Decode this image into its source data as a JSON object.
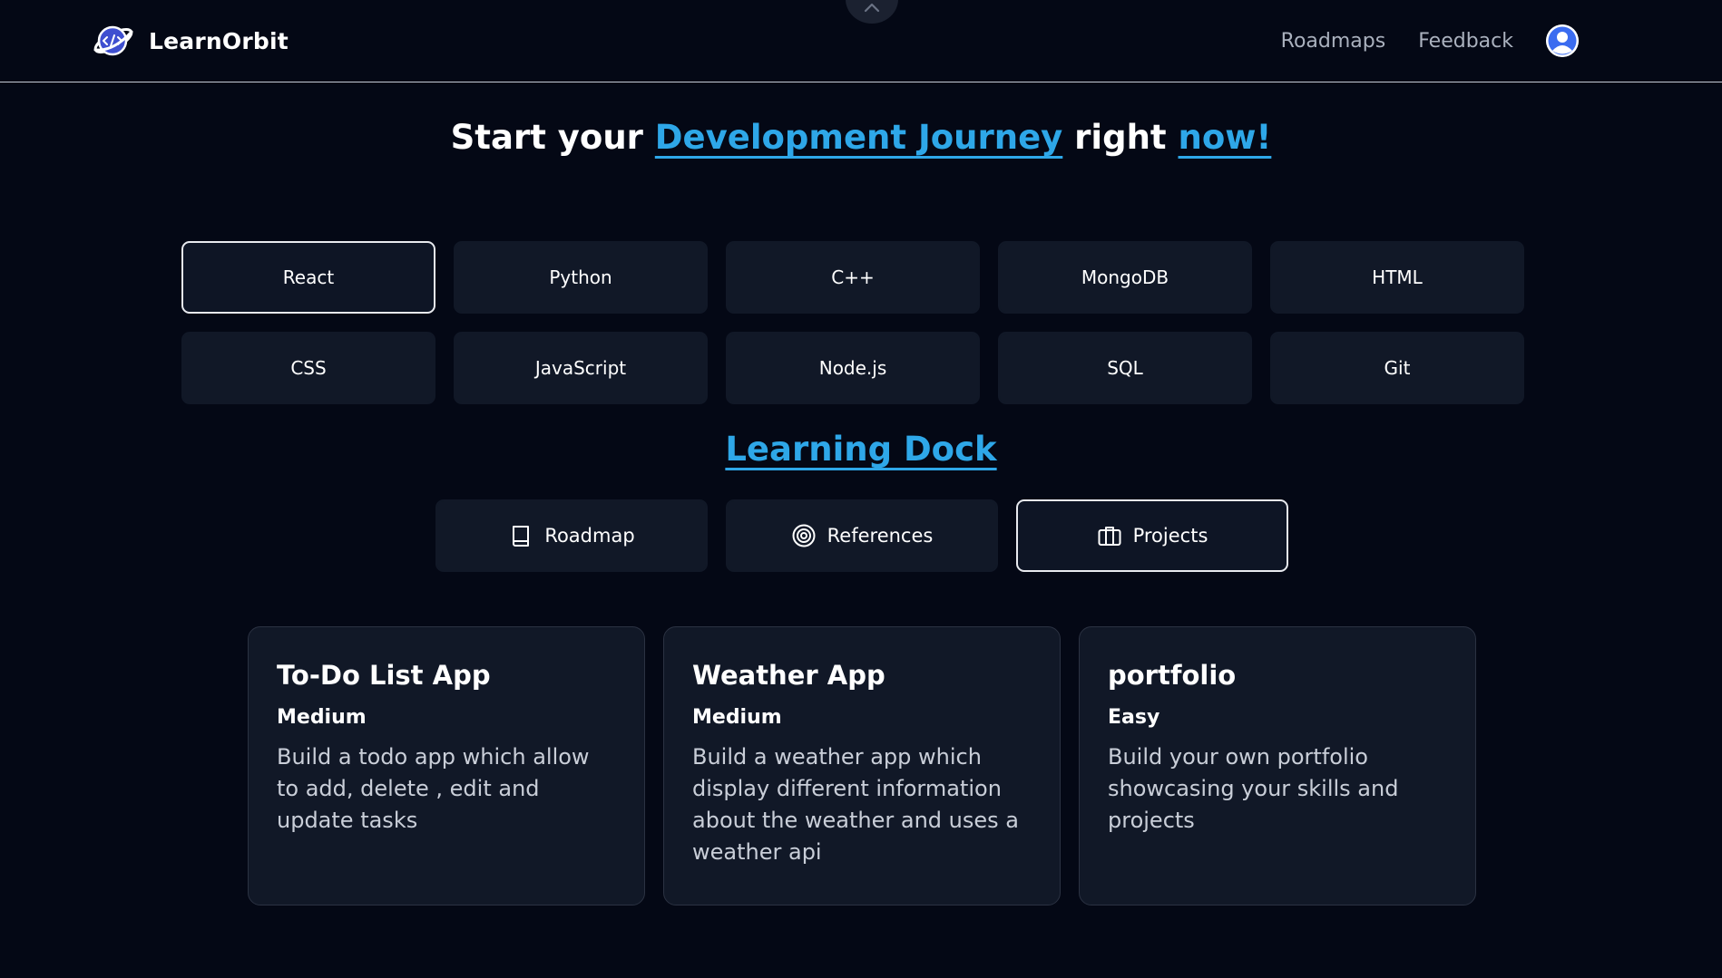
{
  "brand": {
    "name": "LearnOrbit",
    "logo_icon": "planet-code-icon"
  },
  "nav": {
    "links": [
      "Roadmaps",
      "Feedback"
    ],
    "avatar_icon": "user-avatar-icon",
    "collapse_icon": "chevron-up-icon"
  },
  "hero": {
    "part1": "Start your ",
    "highlight1": "Development Journey",
    "part2": " right ",
    "highlight2": "now!"
  },
  "technologies": {
    "items": [
      "React",
      "Python",
      "C++",
      "MongoDB",
      "HTML",
      "CSS",
      "JavaScript",
      "Node.js",
      "SQL",
      "Git"
    ],
    "selected": "React"
  },
  "dock": {
    "title": "Learning Dock",
    "tabs": [
      {
        "label": "Roadmap",
        "icon": "book-icon"
      },
      {
        "label": "References",
        "icon": "target-icon"
      },
      {
        "label": "Projects",
        "icon": "briefcase-icon"
      }
    ],
    "selected": "Projects"
  },
  "projects": [
    {
      "title": "To-Do List App",
      "level": "Medium",
      "description": "Build a todo app which allow to add, delete , edit and update tasks"
    },
    {
      "title": "Weather App",
      "level": "Medium",
      "description": "Build a weather app which display different information about the weather and uses a weather api"
    },
    {
      "title": "portfolio",
      "level": "Easy",
      "description": "Build your own portfolio showcasing your skills and projects"
    }
  ],
  "colors": {
    "background": "#040815",
    "surface": "#111827",
    "accent": "#2ea7e8",
    "border_active": "#e8eaef"
  }
}
